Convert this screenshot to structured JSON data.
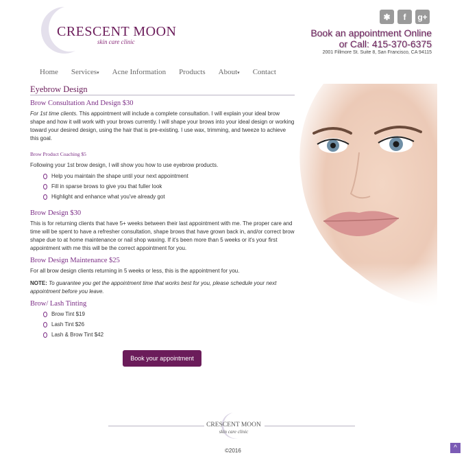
{
  "header": {
    "logo_title": "CRESCENT MOON",
    "logo_subtitle": "skin care clinic",
    "social": [
      {
        "icon": "yelp-icon",
        "glyph": "✱"
      },
      {
        "icon": "facebook-icon",
        "glyph": "f"
      },
      {
        "icon": "google-plus-icon",
        "glyph": "g+"
      }
    ],
    "book_online": "Book an appointment Online",
    "call": "or Call: 415-370-6375",
    "address": "2001 Fillmore St. Suite 8, San Francisco, CA 94115"
  },
  "nav": [
    {
      "label": "Home",
      "dropdown": false
    },
    {
      "label": "Services",
      "dropdown": true
    },
    {
      "label": "Acne Information",
      "dropdown": false
    },
    {
      "label": "Products",
      "dropdown": false
    },
    {
      "label": "About",
      "dropdown": true
    },
    {
      "label": "Contact",
      "dropdown": false
    }
  ],
  "main": {
    "page_title": "Eyebrow Design",
    "s1_title": "Brow Consultation And Design $30",
    "s1_lead": "For 1st time clients.",
    "s1_body": " This appointment will include a complete consultation. I will explain your ideal brow shape and how it will work with your brows currently. I will shape your brows into your ideal design or working toward your desired design, using the hair that is pre-existing. I use wax, trimming, and tweeze to achieve this goal.",
    "s2_title": "Brow Product Coaching $5",
    "s2_body": "Following your 1st brow design, I will show you how to use eyebrow products.",
    "s2_items": [
      "Help you maintain the shape until your next appointment",
      "Fill in sparse brows to give you that fuller look",
      "Highlight and enhance what you've already got"
    ],
    "s3_title": "Brow Design $30",
    "s3_body": "This is for returning clients that have 5+ weeks between their last appointment with me. The proper care and time will be spent to have a refresher consultation, shape brows that have grown back in, and/or correct brow shape due to at home maintenance or nail shop waxing. If it's been more than 5 weeks or it's your first appointment with me this will be the correct appointment for you.",
    "s4_title": "Brow Design Maintenance $25",
    "s4_body": "For all brow design clients returning in 5 weeks or less, this is the appointment for you.",
    "note_label": "NOTE:",
    "note_text": " To guarantee you get the appointment time that works best for you, please schedule your next appointment before you leave.",
    "s5_title": "Brow/ Lash Tinting",
    "s5_items": [
      "Brow Tint $19",
      "Lash Tint $26",
      "Lash & Brow Tint $42"
    ],
    "book_button": "Book your appointment"
  },
  "footer": {
    "logo_title": "CRESCENT MOON",
    "logo_subtitle": "skin care clinic",
    "copyright": "©2016",
    "to_top": "^"
  },
  "colors": {
    "brand": "#6b1c5a",
    "accent": "#7b2d85"
  }
}
